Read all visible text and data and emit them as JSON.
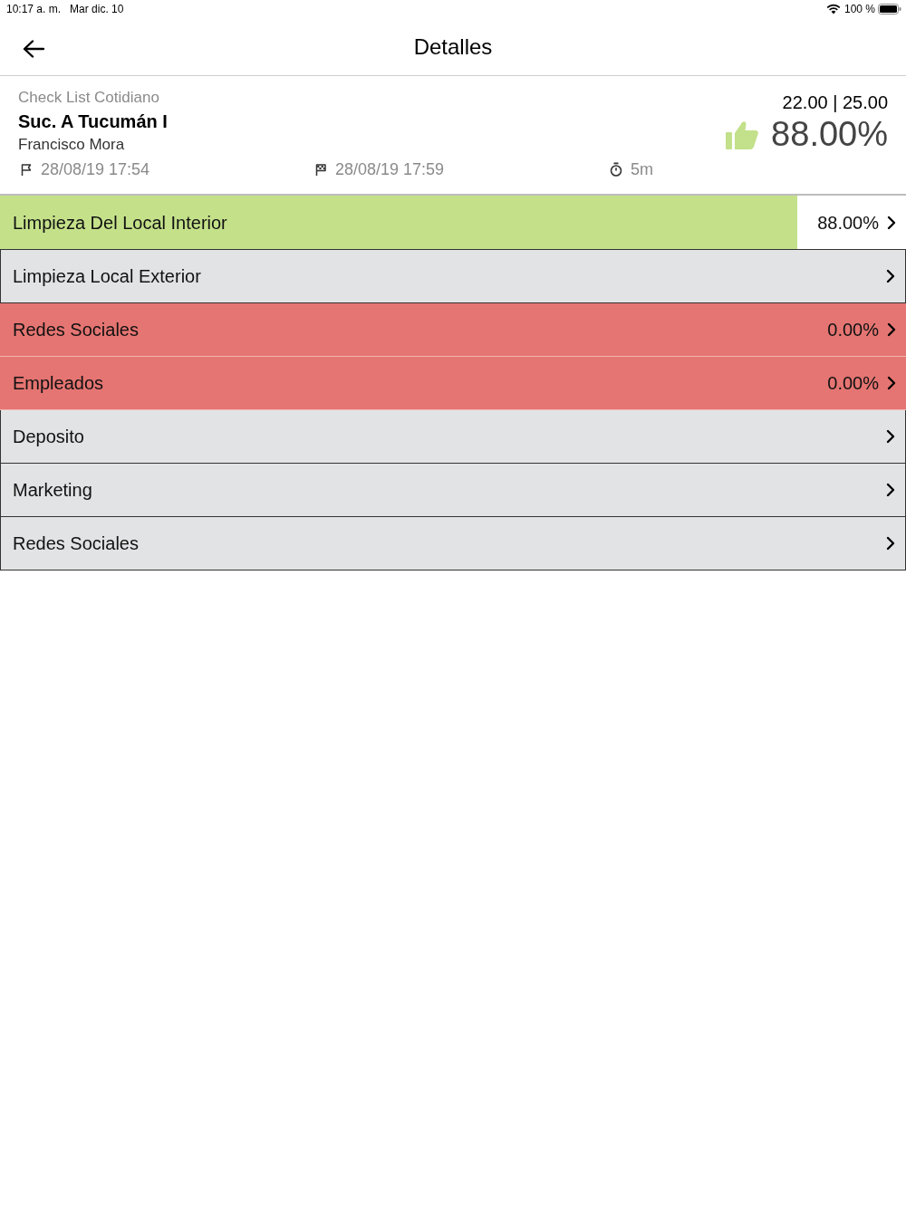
{
  "status_bar": {
    "time": "10:17 a. m.",
    "date": "Mar dic. 10",
    "battery": "100 %"
  },
  "header": {
    "title": "Detalles"
  },
  "summary": {
    "checklist": "Check List Cotidiano",
    "branch": "Suc. A Tucumán I",
    "inspector": "Francisco Mora",
    "started": "28/08/19 17:54",
    "finished": "28/08/19 17:59",
    "duration": "5m",
    "points": "22.00 | 25.00",
    "score": "88.00%"
  },
  "sections": [
    {
      "name": "Limpieza Del Local Interior",
      "kind": "passed",
      "level": 0.88,
      "score": "88.00%"
    },
    {
      "name": "Limpieza Local Exterior",
      "kind": "pending"
    },
    {
      "name": "Redes Sociales",
      "kind": "failed",
      "score": "0.00%"
    },
    {
      "name": "Empleados",
      "kind": "failed",
      "score": "0.00%"
    },
    {
      "name": "Deposito",
      "kind": "pending"
    },
    {
      "name": "Marketing",
      "kind": "pending"
    },
    {
      "name": "Redes Sociales",
      "kind": "pending"
    }
  ]
}
